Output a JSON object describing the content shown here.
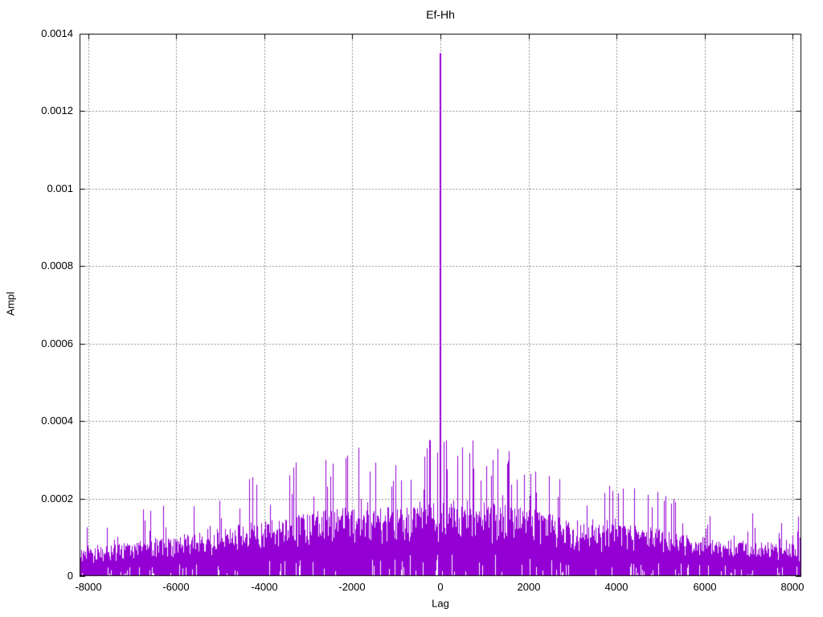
{
  "figure": {
    "background": "#ffffff"
  },
  "chart_data": {
    "type": "line",
    "style": "dense-impulse-noise",
    "title": "Ef-Hh",
    "xlabel": "Lag",
    "ylabel": "Ampl",
    "xlim": [
      -8192,
      8192
    ],
    "ylim": [
      0,
      0.0014
    ],
    "grid": true,
    "legend": "none",
    "series_color": "#9400d3",
    "grid_color": "#909090",
    "axis_color": "#000000",
    "x_ticks": [
      {
        "value": -8000,
        "label": "-8000"
      },
      {
        "value": -6000,
        "label": "-6000"
      },
      {
        "value": -4000,
        "label": "-4000"
      },
      {
        "value": -2000,
        "label": "-2000"
      },
      {
        "value": 0,
        "label": "0"
      },
      {
        "value": 2000,
        "label": "2000"
      },
      {
        "value": 4000,
        "label": "4000"
      },
      {
        "value": 6000,
        "label": "6000"
      },
      {
        "value": 8000,
        "label": "8000"
      }
    ],
    "y_ticks": [
      {
        "value": 0,
        "label": "0"
      },
      {
        "value": 0.0002,
        "label": "0.0002"
      },
      {
        "value": 0.0004,
        "label": "0.0004"
      },
      {
        "value": 0.0006,
        "label": "0.0006"
      },
      {
        "value": 0.0008,
        "label": "0.0008"
      },
      {
        "value": 0.001,
        "label": "0.001"
      },
      {
        "value": 0.0012,
        "label": "0.0012"
      },
      {
        "value": 0.0014,
        "label": "0.0014"
      }
    ],
    "main_peak": {
      "x": 0,
      "y": 0.00135
    },
    "envelope": [
      [
        -8192,
        6e-05
      ],
      [
        -7000,
        8e-05
      ],
      [
        -6000,
        9e-05
      ],
      [
        -5000,
        0.00011
      ],
      [
        -4000,
        0.00013
      ],
      [
        -3000,
        0.00015
      ],
      [
        -2000,
        0.00016
      ],
      [
        -1000,
        0.00016
      ],
      [
        0,
        0.00017
      ],
      [
        500,
        0.00018
      ],
      [
        1000,
        0.00017
      ],
      [
        2000,
        0.00016
      ],
      [
        3000,
        0.00013
      ],
      [
        4000,
        0.00012
      ],
      [
        5000,
        0.00011
      ],
      [
        6000,
        9e-05
      ],
      [
        7000,
        8e-05
      ],
      [
        8192,
        7.5e-05
      ]
    ],
    "notable_spikes": [
      [
        -5600,
        0.00018
      ],
      [
        -4350,
        0.00025
      ],
      [
        -3430,
        0.00026
      ],
      [
        -2600,
        0.0003
      ],
      [
        -2450,
        0.00029
      ],
      [
        -2150,
        0.00028
      ],
      [
        -1600,
        0.00027
      ],
      [
        -310,
        0.00033
      ],
      [
        -237,
        0.00035
      ],
      [
        380,
        0.00031
      ],
      [
        730,
        0.00035
      ],
      [
        1190,
        0.0003
      ],
      [
        1520,
        0.00029
      ],
      [
        2160,
        0.00027
      ],
      [
        2700,
        0.00025
      ],
      [
        3900,
        0.00022
      ],
      [
        4700,
        0.00021
      ],
      [
        5300,
        0.00019
      ]
    ],
    "noise_seed": 424242
  }
}
